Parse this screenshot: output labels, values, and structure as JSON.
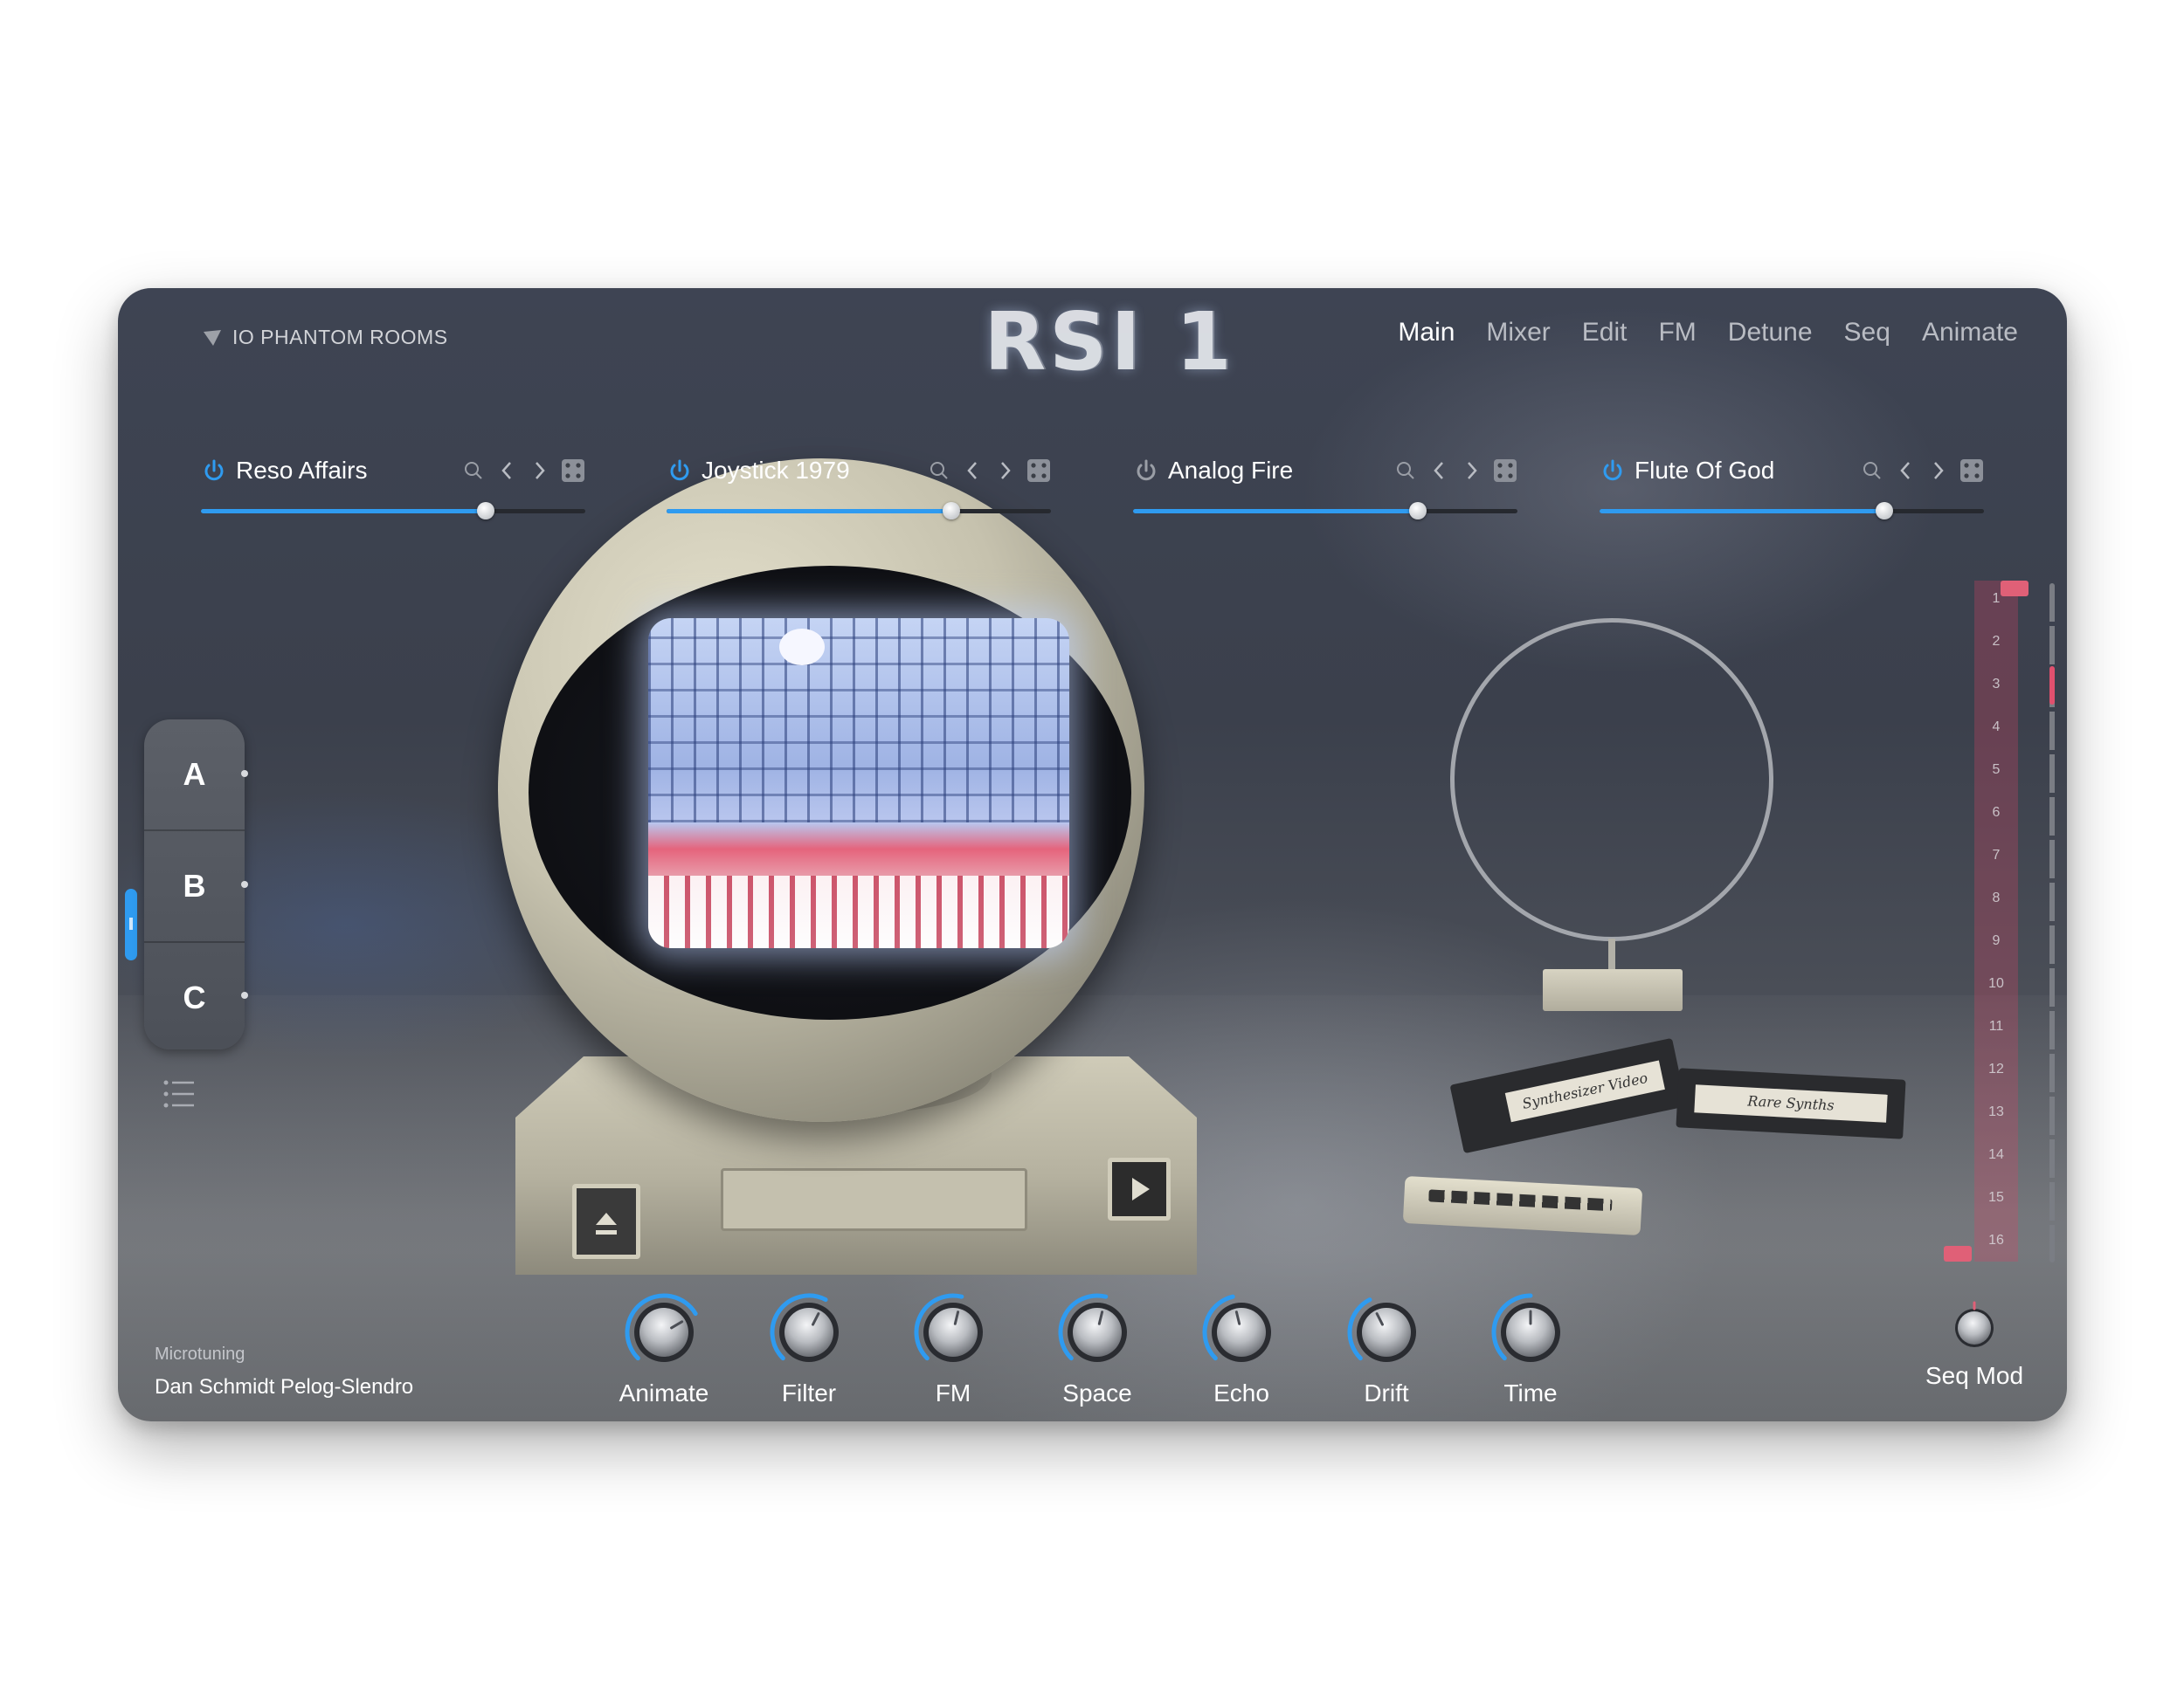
{
  "header": {
    "brand": "IO PHANTOM ROOMS",
    "title": "RSI 1",
    "tabs": [
      {
        "label": "Main",
        "active": true
      },
      {
        "label": "Mixer"
      },
      {
        "label": "Edit"
      },
      {
        "label": "FM"
      },
      {
        "label": "Detune"
      },
      {
        "label": "Seq"
      },
      {
        "label": "Animate"
      }
    ]
  },
  "layers": [
    {
      "name": "Reso Affairs",
      "level": 0.74
    },
    {
      "name": "Joystick 1979",
      "level": 0.74
    },
    {
      "name": "Analog Fire",
      "level": 0.74
    },
    {
      "name": "Flute Of God",
      "level": 0.74
    }
  ],
  "side": {
    "buttons": [
      "A",
      "B",
      "C"
    ],
    "list_icon": "list-icon"
  },
  "scene": {
    "tape1_label": "Synthesizer Video",
    "tape2_label": "Rare Synths"
  },
  "sequencer": {
    "steps": [
      "1",
      "2",
      "3",
      "4",
      "5",
      "6",
      "7",
      "8",
      "9",
      "10",
      "11",
      "12",
      "13",
      "14",
      "15",
      "16"
    ],
    "active_step": 3
  },
  "footer": {
    "microtuning_label": "Microtuning",
    "microtuning_value": "Dan Schmidt Pelog-Slendro",
    "macros": [
      {
        "label": "Animate",
        "value": 0.72
      },
      {
        "label": "Filter",
        "value": 0.6
      },
      {
        "label": "FM",
        "value": 0.55
      },
      {
        "label": "Space",
        "value": 0.55
      },
      {
        "label": "Echo",
        "value": 0.45
      },
      {
        "label": "Drift",
        "value": 0.4
      },
      {
        "label": "Time",
        "value": 0.5
      }
    ],
    "seq_mod_label": "Seq Mod"
  },
  "colors": {
    "accent": "#2f9bf0",
    "seq": "#e06077",
    "text": "#ffffff"
  }
}
